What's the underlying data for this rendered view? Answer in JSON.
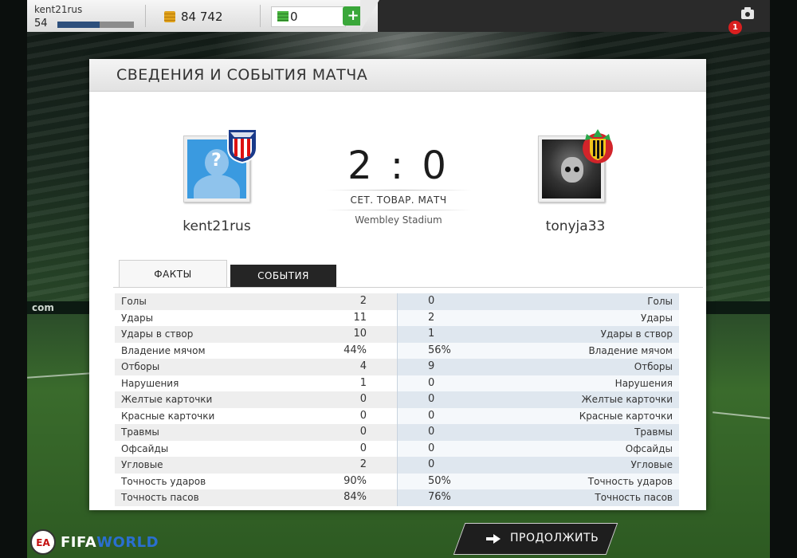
{
  "topbar": {
    "player_name": "kent21rus",
    "level": "54",
    "xp_fraction": 0.55,
    "coins": "84 742",
    "fifa_points": "0",
    "add_label": "+",
    "notification_count": "1"
  },
  "panel": {
    "title": "СВЕДЕНИЯ И СОБЫТИЯ МАТЧА"
  },
  "match": {
    "home_player": "kent21rus",
    "away_player": "tonyja33",
    "score": "2 : 0",
    "match_type": "СЕТ. ТОВАР. МАТЧ",
    "stadium": "Wembley Stadium"
  },
  "tabs": {
    "facts": "ФАКТЫ",
    "events": "СОБЫТИЯ"
  },
  "stats": [
    {
      "label": "Голы",
      "home": "2",
      "away": "0"
    },
    {
      "label": "Удары",
      "home": "11",
      "away": "2"
    },
    {
      "label": "Удары в створ",
      "home": "10",
      "away": "1"
    },
    {
      "label": "Владение мячом",
      "home": "44%",
      "away": "56%"
    },
    {
      "label": "Отборы",
      "home": "4",
      "away": "9"
    },
    {
      "label": "Нарушения",
      "home": "1",
      "away": "0"
    },
    {
      "label": "Желтые карточки",
      "home": "0",
      "away": "0"
    },
    {
      "label": "Красные карточки",
      "home": "0",
      "away": "0"
    },
    {
      "label": "Травмы",
      "home": "0",
      "away": "0"
    },
    {
      "label": "Офсайды",
      "home": "0",
      "away": "0"
    },
    {
      "label": "Угловые",
      "home": "2",
      "away": "0"
    },
    {
      "label": "Точность ударов",
      "home": "90%",
      "away": "50%"
    },
    {
      "label": "Точность пасов",
      "home": "84%",
      "away": "76%"
    }
  ],
  "footer": {
    "ea_label": "EA",
    "logo_fifa": "FIFA",
    "logo_world": "WORLD",
    "continue_label": "ПРОДОЛЖИТЬ"
  },
  "background": {
    "board_text": "com"
  },
  "icons": {
    "coins": "coins-icon",
    "points": "fifa-points-icon",
    "camera": "camera-icon",
    "continue": "arrow-right-icon"
  },
  "colors": {
    "accent_green": "#3aa73a",
    "xp_blue": "#2d4f7c",
    "badge_red": "#d91f1f"
  }
}
